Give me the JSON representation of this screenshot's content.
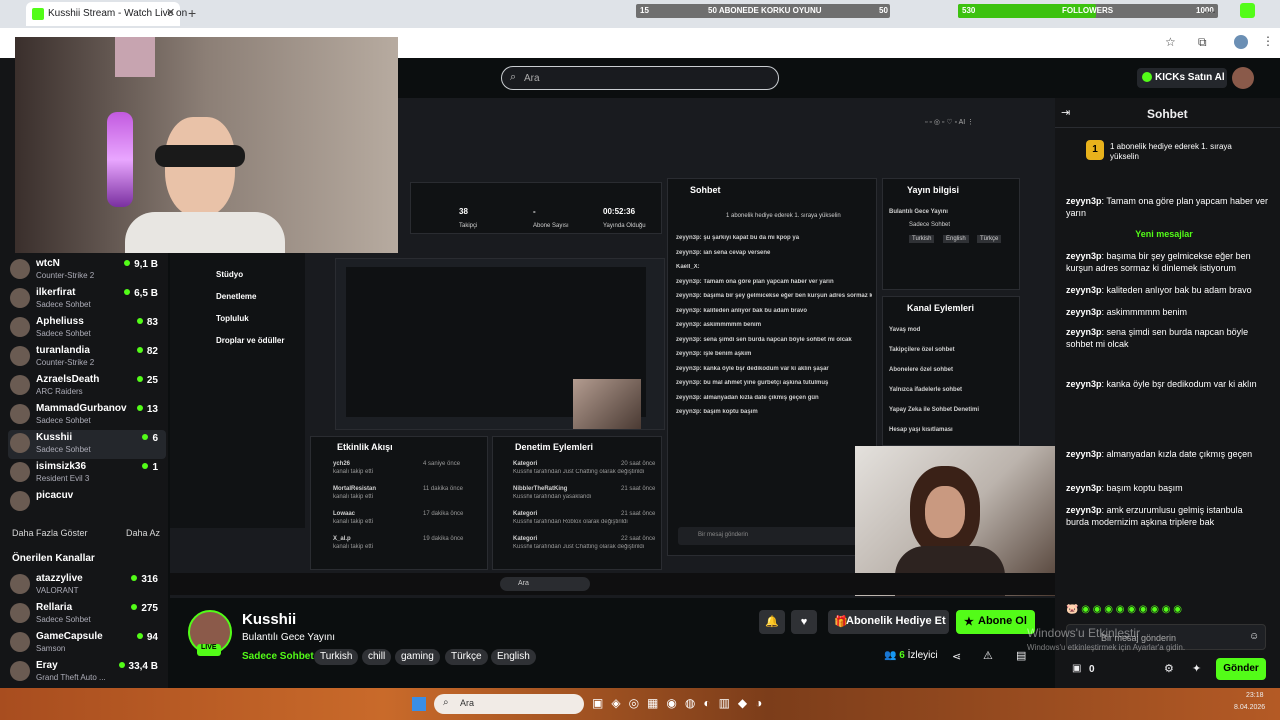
{
  "browser": {
    "tab_title": "Kusshii Stream - Watch Live on",
    "goal_bar_left": {
      "start": "15",
      "label": "50 ABONEDE KORKU OYUNU",
      "end": "50"
    },
    "goal_bar_right": {
      "start": "530",
      "label": "FOLLOWERS",
      "end": "1000"
    }
  },
  "header": {
    "search_placeholder": "Ara",
    "buy_kicks": "KICKs Satın Al"
  },
  "sidebar": {
    "channels": [
      {
        "name": "wtcN",
        "category": "Counter-Strike 2",
        "viewers": "9,1 B"
      },
      {
        "name": "ilkerfirat",
        "category": "Sadece Sohbet",
        "viewers": "6,5 B"
      },
      {
        "name": "Apheliuss",
        "category": "Sadece Sohbet",
        "viewers": "83"
      },
      {
        "name": "turanlandia",
        "category": "Counter-Strike 2",
        "viewers": "82"
      },
      {
        "name": "AzraelsDeath",
        "category": "ARC Raiders",
        "viewers": "25"
      },
      {
        "name": "MammadGurbanov",
        "category": "Sadece Sohbet",
        "viewers": "13"
      },
      {
        "name": "Kusshii",
        "category": "Sadece Sohbet",
        "viewers": "6"
      },
      {
        "name": "isimsizk36",
        "category": "Resident Evil 3",
        "viewers": "1"
      },
      {
        "name": "picacuv",
        "category": "",
        "viewers": ""
      }
    ],
    "show_more": "Daha Fazla Göster",
    "show_less": "Daha Az",
    "recommended_title": "Önerilen Kanallar",
    "recommended": [
      {
        "name": "atazzylive",
        "category": "VALORANT",
        "viewers": "316"
      },
      {
        "name": "Rellaria",
        "category": "Sadece Sohbet",
        "viewers": "275"
      },
      {
        "name": "GameCapsule",
        "category": "Samson",
        "viewers": "94"
      },
      {
        "name": "Eray",
        "category": "Grand Theft Auto ...",
        "viewers": "33,4 B"
      }
    ]
  },
  "inner_screen": {
    "menu": [
      "Stüdyo",
      "Denetleme",
      "Topluluk",
      "Droplar ve ödüller"
    ],
    "stats": [
      {
        "value": "38",
        "label": "Takipçi"
      },
      {
        "value": "-",
        "label": "Abone Sayısı"
      },
      {
        "value": "00:52:36",
        "label": "Yayında Olduğu"
      }
    ],
    "chat_title": "Sohbet",
    "chat_pinned": "1 abonelik hediye ederek 1. sıraya yükselin",
    "chat_lines": [
      "zeyyn3p: şu şarkıyı kapat bu da mı kpop ya",
      "zeyyn3p: ian sena cevap versene",
      "Kaell_X:",
      "zeyyn3p: Tamam ona göre plan yapcam haber ver yarın",
      "zeyyn3p: başıma bir şey gelmicekse eğer ben kurşun adres sormaz ki dinlemek istiyorum",
      "zeyyn3p: kaliteden anlıyor bak bu adam bravo",
      "zeyyn3p: askimmmmm benim",
      "zeyyn3p: sena şimdi sen burda napcan böyle sohbet mi olcak",
      "zeyyn3p: işle benim aşkım",
      "zeyyn3p: kanka öyle bşr dedikodum var ki aklın şaşar",
      "zeyyn3p: bu mal ahmet yine gurbetçi aşkına tutulmuş",
      "zeyyn3p: almanyadan kızla date çıkmış geçen gün",
      "zeyyn3p: başım koptu başım"
    ],
    "chat_input": "Bir mesaj gönderin",
    "stream_info_title": "Yayın bilgisi",
    "stream_info_name": "Bulantılı Gece Yayını",
    "stream_info_cat": "Sadece Sohbet",
    "stream_info_tags": [
      "Turkish",
      "English",
      "Türkçe"
    ],
    "channel_actions_title": "Kanal Eylemleri",
    "channel_actions": [
      "Yavaş mod",
      "Takipçilere özel sohbet",
      "Abonelere özel sohbet",
      "Yalnızca ifadelerle sohbet",
      "Yapay Zeka ile Sohbet Denetimi",
      "Hesap yaşı kısıtlaması"
    ],
    "activity_title": "Etkinlik Akışı",
    "activity": [
      {
        "user": "ych26",
        "action": "kanalı takip etti",
        "time": "4 saniye önce"
      },
      {
        "user": "MortalResistan",
        "action": "kanalı takip etti",
        "time": "11 dakika önce"
      },
      {
        "user": "Lowaac",
        "action": "kanalı takip etti",
        "time": "17 dakika önce"
      },
      {
        "user": "X_al.p",
        "action": "kanalı takip etti",
        "time": "19 dakika önce"
      }
    ],
    "moderation_title": "Denetim Eylemleri",
    "moderation": [
      {
        "title": "Kategori",
        "detail": "Kusshii tarafından Just Chatting olarak değiştirildi",
        "time": "20 saat önce"
      },
      {
        "title": "NibblerTheRatKing",
        "detail": "Kusshii tarafından yasaklandı",
        "time": "21 saat önce"
      },
      {
        "title": "Kategori",
        "detail": "Kusshii tarafından Roblox olarak değiştirildi",
        "time": "21 saat önce"
      },
      {
        "title": "Kategori",
        "detail": "Kusshii tarafından Just Chatting olarak değiştirildi",
        "time": "22 saat önce"
      }
    ],
    "taskbar_search": "Ara"
  },
  "stream": {
    "streamer": "Kusshii",
    "title": "Bulantılı Gece Yayını",
    "category": "Sadece Sohbet",
    "tags": [
      "Turkish",
      "chill",
      "gaming",
      "Türkçe",
      "English"
    ],
    "live_badge": "LIVE",
    "gift_label": "Abonelik Hediye Et",
    "subscribe_label": "Abone Ol",
    "viewers_count": "6",
    "viewers_label": "İzleyici"
  },
  "chat": {
    "title": "Sohbet",
    "pinned": "1 abonelik hediye ederek 1. sıraya yükselin",
    "pinned_rank": "1",
    "first_message": {
      "user": "zeyyn3p",
      "text": "Tamam ona göre plan yapcam haber ver yarın"
    },
    "new_messages": "Yeni mesajlar",
    "messages": [
      {
        "user": "zeyyn3p",
        "text": "başıma bir şey gelmicekse eğer ben kurşun adres sormaz ki dinlemek istiyorum"
      },
      {
        "user": "zeyyn3p",
        "text": "kaliteden anlıyor bak bu adam bravo"
      },
      {
        "user": "zeyyn3p",
        "text": "askimmmmm benim"
      },
      {
        "user": "zeyyn3p",
        "text": "sena şimdi sen burda napcan böyle sohbet mi olcak"
      },
      {
        "user": "zeyyn3p",
        "text": "kanka öyle bşr dedikodum var ki aklın"
      },
      {
        "user": "zeyyn3p",
        "text": "almanyadan kızla date çıkmış geçen"
      },
      {
        "user": "zeyyn3p",
        "text": "başım koptu başım"
      },
      {
        "user": "zeyyn3p",
        "text": "amk erzurumlusu gelmiş istanbula burda modernizim aşkına triplere bak"
      }
    ],
    "input_placeholder": "Bir mesaj gönderin",
    "points": "0",
    "send_label": "Gönder"
  },
  "windows": {
    "activate_title": "Windows'u Etkinleştir",
    "activate_sub": "Windows'u etkinleştirmek için Ayarlar'a gidin.",
    "search": "Ara",
    "time": "23:18",
    "date": "8.04.2026"
  }
}
